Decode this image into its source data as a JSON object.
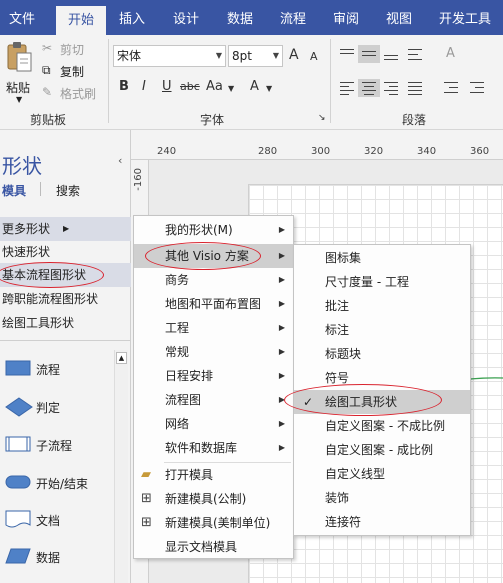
{
  "tabs": [
    "文件",
    "开始",
    "插入",
    "设计",
    "数据",
    "流程",
    "审阅",
    "视图",
    "开发工具"
  ],
  "active_tab": "开始",
  "clipboard": {
    "paste": "粘贴",
    "cut": "剪切",
    "copy": "复制",
    "format_painter": "格式刷",
    "group_label": "剪贴板"
  },
  "font": {
    "name": "宋体",
    "size": "8pt",
    "bold": "B",
    "italic": "I",
    "underline": "U",
    "strike": "abc",
    "case": "Aa",
    "color": "A",
    "grow": "A",
    "shrink": "A",
    "group_label": "字体"
  },
  "paragraph": {
    "group_label": "段落"
  },
  "left_pane": {
    "title": "形状",
    "tab_stencils": "模具",
    "tab_search": "搜索",
    "items": [
      "更多形状",
      "快速形状",
      "基本流程图形状",
      "跨职能流程图形状",
      "绘图工具形状"
    ],
    "shapes": [
      "流程",
      "判定",
      "子流程",
      "开始/结束",
      "文档",
      "数据"
    ]
  },
  "ruler": {
    "h_ticks": [
      "240",
      "280",
      "300",
      "320",
      "340",
      "360"
    ],
    "v_tick": "-160"
  },
  "menu1": {
    "items": [
      "我的形状(M)",
      "其他 Visio 方案",
      "商务",
      "地图和平面布置图",
      "工程",
      "常规",
      "日程安排",
      "流程图",
      "网络",
      "软件和数据库"
    ],
    "actions": [
      "打开模具",
      "新建模具(公制)",
      "新建模具(美制单位)",
      "显示文档模具"
    ]
  },
  "menu2": {
    "items": [
      "图标集",
      "尺寸度量 - 工程",
      "批注",
      "标注",
      "标题块",
      "符号",
      "绘图工具形状",
      "自定义图案 - 不成比例",
      "自定义图案 - 成比例",
      "自定义线型",
      "装饰",
      "连接符"
    ],
    "checked": "绘图工具形状"
  },
  "colors": {
    "ribbon_blue": "#3955a3",
    "shape_blue": "#4f81c7",
    "annotation_red": "#d9232e"
  }
}
